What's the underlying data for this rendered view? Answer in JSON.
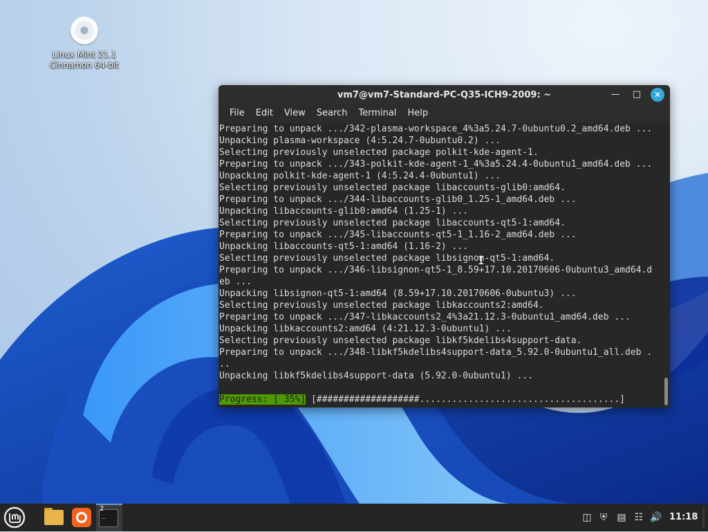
{
  "desktop": {
    "icon_label_line1": "Linux Mint 21.1",
    "icon_label_line2": "Cinnamon 64-bit",
    "icon": "disc-icon"
  },
  "terminal": {
    "title": "vm7@vm7-Standard-PC-Q35-ICH9-2009: ~",
    "menu": [
      "File",
      "Edit",
      "View",
      "Search",
      "Terminal",
      "Help"
    ],
    "lines": [
      "Preparing to unpack .../342-plasma-workspace_4%3a5.24.7-0ubuntu0.2_amd64.deb ...",
      "Unpacking plasma-workspace (4:5.24.7-0ubuntu0.2) ...",
      "Selecting previously unselected package polkit-kde-agent-1.",
      "Preparing to unpack .../343-polkit-kde-agent-1_4%3a5.24.4-0ubuntu1_amd64.deb ...",
      "Unpacking polkit-kde-agent-1 (4:5.24.4-0ubuntu1) ...",
      "Selecting previously unselected package libaccounts-glib0:amd64.",
      "Preparing to unpack .../344-libaccounts-glib0_1.25-1_amd64.deb ...",
      "Unpacking libaccounts-glib0:amd64 (1.25-1) ...",
      "Selecting previously unselected package libaccounts-qt5-1:amd64.",
      "Preparing to unpack .../345-libaccounts-qt5-1_1.16-2_amd64.deb ...",
      "Unpacking libaccounts-qt5-1:amd64 (1.16-2) ...",
      "Selecting previously unselected package libsignon-qt5-1:amd64.",
      "Preparing to unpack .../346-libsignon-qt5-1_8.59+17.10.20170606-0ubuntu3_amd64.d",
      "eb ...",
      "Unpacking libsignon-qt5-1:amd64 (8.59+17.10.20170606-0ubuntu3) ...",
      "Selecting previously unselected package libkaccounts2:amd64.",
      "Preparing to unpack .../347-libkaccounts2_4%3a21.12.3-0ubuntu1_amd64.deb ...",
      "Unpacking libkaccounts2:amd64 (4:21.12.3-0ubuntu1) ...",
      "Selecting previously unselected package libkf5kdelibs4support-data.",
      "Preparing to unpack .../348-libkf5kdelibs4support-data_5.92.0-0ubuntu1_all.deb .",
      "..",
      "Unpacking libkf5kdelibs4support-data (5.92.0-0ubuntu1) ..."
    ],
    "progress_label": "Progress: [ 35%]",
    "progress_bar": " [###################.....................................]",
    "progress_percent": 35,
    "progress_color": "#4e9a06"
  },
  "panel": {
    "clock": "11:18",
    "terminal_badge": "2",
    "tray_icons": [
      "clipboard-icon",
      "shield-icon",
      "update-manager-icon",
      "network-icon",
      "volume-icon"
    ]
  }
}
